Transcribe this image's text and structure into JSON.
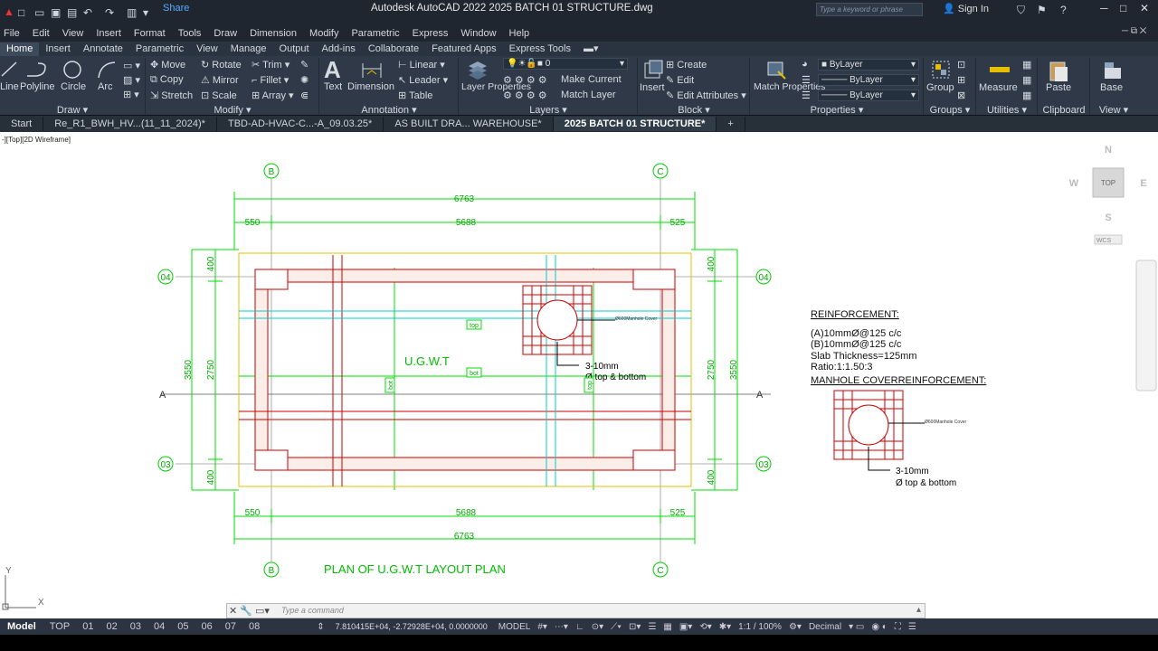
{
  "titlebar": {
    "share": "Share",
    "title": "Autodesk AutoCAD 2022    2025 BATCH 01 STRUCTURE.dwg",
    "search_placeholder": "Type a keyword or phrase",
    "signin": "Sign In"
  },
  "menu": [
    "File",
    "Edit",
    "View",
    "Insert",
    "Format",
    "Tools",
    "Draw",
    "Dimension",
    "Modify",
    "Parametric",
    "Express",
    "Window",
    "Help"
  ],
  "ribbon_tabs": [
    "Home",
    "Insert",
    "Annotate",
    "Parametric",
    "View",
    "Manage",
    "Output",
    "Add-ins",
    "Collaborate",
    "Featured Apps",
    "Express Tools"
  ],
  "ribbon": {
    "draw": {
      "title": "Draw",
      "line": "Line",
      "polyline": "Polyline",
      "circle": "Circle",
      "arc": "Arc"
    },
    "modify": {
      "title": "Modify",
      "move": "Move",
      "rotate": "Rotate",
      "trim": "Trim",
      "copy": "Copy",
      "mirror": "Mirror",
      "fillet": "Fillet",
      "stretch": "Stretch",
      "scale": "Scale",
      "array": "Array"
    },
    "annotation": {
      "title": "Annotation",
      "text": "Text",
      "dimension": "Dimension",
      "linear": "Linear",
      "leader": "Leader",
      "table": "Table"
    },
    "layers": {
      "title": "Layers",
      "layer_properties": "Layer Properties",
      "current_layer": "0",
      "make_current": "Make Current",
      "match_layer": "Match Layer"
    },
    "block": {
      "title": "Block",
      "insert": "Insert",
      "create": "Create",
      "edit": "Edit",
      "edit_attributes": "Edit Attributes"
    },
    "properties": {
      "title": "Properties",
      "match_properties": "Match Properties",
      "color": "ByLayer",
      "linetype": "ByLayer",
      "lineweight": "ByLayer"
    },
    "groups": {
      "title": "Groups",
      "group": "Group"
    },
    "utilities": {
      "title": "Utilities",
      "measure": "Measure"
    },
    "clipboard": {
      "title": "Clipboard",
      "paste": "Paste"
    },
    "view": {
      "title": "View",
      "base": "Base"
    }
  },
  "doc_tabs": [
    "Start",
    "Re_R1_BWH_HV...(11_11_2024)*",
    "TBD-AD-HVAC-C...-A_09.03.25*",
    "AS BUILT DRA... WAREHOUSE*",
    "2025 BATCH 01 STRUCTURE*"
  ],
  "viewport_label": "-][Top][2D Wireframe]",
  "viewcube": {
    "n": "N",
    "s": "S",
    "e": "E",
    "w": "W",
    "top": "TOP",
    "wcs": "WCS"
  },
  "drawing": {
    "grid_b": "B",
    "grid_c": "C",
    "grid_04": "04",
    "grid_03": "03",
    "section_a": "A",
    "dim_total": "6763",
    "dim_left": "550",
    "dim_mid": "5688",
    "dim_right": "525",
    "dim_side_total": "3550",
    "dim_side_mid": "2750",
    "dim_side_edge": "400",
    "label_ugwt": "U.G.W.T",
    "label_top": "top",
    "label_bot": "bot",
    "manhole_note": "Ø600Manhole Cover",
    "bar_line1": "3-10mm",
    "bar_line2": "Ø top & bottom",
    "title": "PLAN OF U.G.W.T LAYOUT PLAN",
    "reinforcement_title": "REINFORCEMENT:",
    "reinforcement_lines": [
      "(A)10mmØ@125 c/c",
      "(B)10mmØ@125 c/c",
      "Slab Thickness=125mm",
      "Ratio:1:1.50:3"
    ],
    "manhole_title": "MANHOLE COVERREINFORCEMENT:",
    "detail_note": "Ø600Manhole Cover",
    "detail_bar1": "3-10mm",
    "detail_bar2": "Ø top & bottom",
    "ucs_y": "Y",
    "ucs_x": "X"
  },
  "command": {
    "placeholder": "Type a command"
  },
  "status": {
    "model": "Model",
    "layouts": [
      "TOP",
      "01",
      "02",
      "03",
      "04",
      "05",
      "06",
      "07",
      "08"
    ],
    "coords": "7.810415E+04, -2.72928E+04, 0.0000000",
    "space": "MODEL",
    "scale": "1:1 / 100%",
    "units": "Decimal"
  },
  "colors": {
    "green": "#00dd00",
    "red": "#cc0000",
    "cyan": "#00dddd",
    "yellow": "#e6c000",
    "gray": "#999999",
    "accent": "#5aa9ff"
  }
}
